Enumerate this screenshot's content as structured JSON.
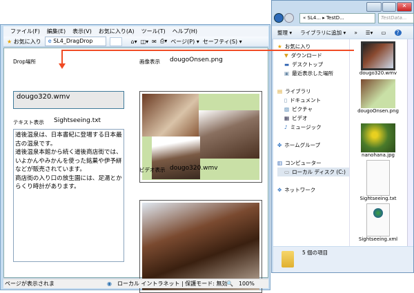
{
  "ie": {
    "menu": [
      "ファイル(F)",
      "編集(E)",
      "表示(V)",
      "お気に入り(A)",
      "ツール(T)",
      "ヘルプ(H)"
    ],
    "favorites_label": "お気に入り",
    "tab_title": "SL4_DragDrop",
    "toolbar": {
      "page": "ページ(P) ▾",
      "safety": "セーフティ(S) ▾"
    },
    "page": {
      "drop_label": "Drop場所",
      "drop_value": "dougo320.wmv",
      "text_label": "テキスト表示",
      "text_file": "Sightseeing.txt",
      "text_content": "道後温泉は、日本書紀に登場する日本最古の温泉です。\n道後温泉本館から続く道後商店街では、いよかんやみかんを使った銘菓や伊予絣などが販売されています。\n商店街の入り口の放生園には、足湯とからくり時計があります。",
      "image_label": "画像表示",
      "image_file": "dougoOnsen.png",
      "video_label": "ビデオ表示",
      "video_file": "dougo320.wmv"
    },
    "status": {
      "text": "ページが表示されま",
      "zone": "ローカル イントラネット | 保護モード: 無効",
      "zoom": "100%"
    }
  },
  "explorer": {
    "address": "« SL4... ▸ TestD...",
    "search_placeholder": "TestData...",
    "toolbar": {
      "organize": "整理 ▾",
      "add_library": "ライブラリに追加 ▾",
      "more": "»"
    },
    "nav": [
      {
        "label": "お気に入り",
        "icon": "star-icon",
        "indent": false
      },
      {
        "label": "ダウンロード",
        "icon": "download-folder-icon",
        "indent": true
      },
      {
        "label": "デスクトップ",
        "icon": "desktop-icon",
        "indent": true
      },
      {
        "label": "最近表示した場所",
        "icon": "recent-places-icon",
        "indent": true
      },
      {
        "label": "",
        "icon": "",
        "indent": false
      },
      {
        "label": "ライブラリ",
        "icon": "library-icon",
        "indent": false
      },
      {
        "label": "ドキュメント",
        "icon": "document-icon",
        "indent": true
      },
      {
        "label": "ピクチャ",
        "icon": "pictures-icon",
        "indent": true
      },
      {
        "label": "ビデオ",
        "icon": "video-icon",
        "indent": true
      },
      {
        "label": "ミュージック",
        "icon": "music-icon",
        "indent": true
      },
      {
        "label": "",
        "icon": "",
        "indent": false
      },
      {
        "label": "ホームグループ",
        "icon": "homegroup-icon",
        "indent": false
      },
      {
        "label": "",
        "icon": "",
        "indent": false
      },
      {
        "label": "コンピューター",
        "icon": "computer-icon",
        "indent": false
      },
      {
        "label": "ローカル ディスク (C:)",
        "icon": "drive-icon",
        "indent": true
      },
      {
        "label": "",
        "icon": "",
        "indent": false
      },
      {
        "label": "ネットワーク",
        "icon": "network-icon",
        "indent": false
      }
    ],
    "files": [
      {
        "name": "dougo320.wmv",
        "type": "video"
      },
      {
        "name": "dougoOnsen.png",
        "type": "image"
      },
      {
        "name": "nanohana.jpg",
        "type": "photo"
      },
      {
        "name": "Sightseeing.txt",
        "type": "text"
      },
      {
        "name": "Sightseeing.xml",
        "type": "xml"
      }
    ],
    "status": "5 個の項目"
  },
  "colors": {
    "arrow": "#f04a23",
    "accent": "#3f7a9a"
  }
}
